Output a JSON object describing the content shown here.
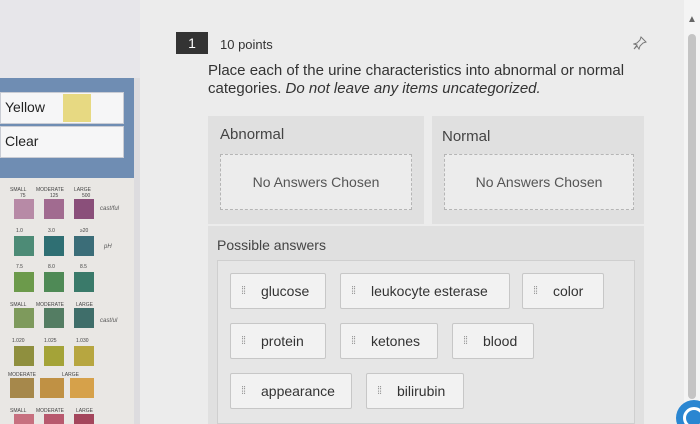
{
  "sidebar_image": {
    "rows": [
      {
        "label": "Yellow",
        "swatch_color": "#e7d982"
      },
      {
        "label": "Clear"
      }
    ],
    "strip_chart_labels": {
      "row1": [
        "SMALL",
        "MODERATE",
        "LARGE"
      ],
      "row1_values": [
        "75",
        "125",
        "500"
      ],
      "row2_values": [
        "1.0",
        "3.0",
        "≥20"
      ],
      "row3_values": [
        "7.5",
        "8.0",
        "8.5"
      ],
      "row4_labels": [
        "SMALL",
        "MODERATE",
        "LARGE"
      ],
      "row5_values": [
        "1.020",
        "1.025",
        "1.030"
      ],
      "row6_labels": [
        "MODERATE",
        "LARGE"
      ],
      "row7_labels": [
        "SMALL",
        "MODERATE",
        "LARGE"
      ]
    },
    "handwritten_notes": [
      "cast/ful",
      "pH",
      "cast/ul"
    ]
  },
  "question": {
    "number": "1",
    "points": "10 points",
    "prompt_main": "Place each of the urine characteristics into abnormal or normal categories.",
    "prompt_emphasis": "Do not leave any items uncategorized."
  },
  "categories": [
    {
      "title": "Abnormal",
      "empty_text": "No Answers Chosen"
    },
    {
      "title": "Normal",
      "empty_text": "No Answers Chosen"
    }
  ],
  "possible_answers": {
    "title": "Possible answers",
    "items": [
      "glucose",
      "leukocyte esterase",
      "color",
      "protein",
      "ketones",
      "blood",
      "appearance",
      "bilirubin"
    ]
  },
  "icons": {
    "pin": "pin-icon",
    "grip": "drag-handle-icon",
    "scroll_up": "scroll-up-arrow-icon",
    "fab": "help-button-icon"
  },
  "colors": {
    "question_badge": "#333333",
    "frame_blue": "#6f8db3",
    "fab_blue": "#2a86d1"
  }
}
